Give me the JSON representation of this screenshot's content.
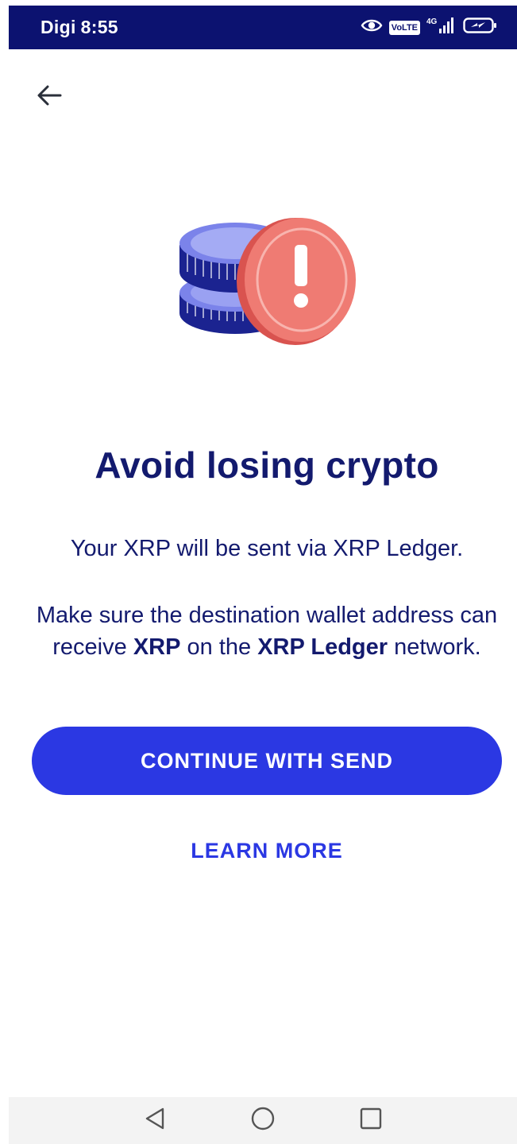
{
  "status_bar": {
    "carrier": "Digi",
    "time": "8:55",
    "volte": "VoLTE",
    "network": "4G"
  },
  "content": {
    "title": "Avoid losing crypto",
    "line1": "Your XRP will be sent via XRP Ledger.",
    "para2_part1": "Make sure the destination wallet address can receive ",
    "para2_bold1": "XRP",
    "para2_part2": " on the ",
    "para2_bold2": "XRP Ledger",
    "para2_part3": " network."
  },
  "actions": {
    "continue_label": "CONTINUE WITH SEND",
    "learn_more_label": "LEARN MORE"
  },
  "icons": {
    "back": "arrow-left-icon",
    "illustration": "coins-warning-illustration",
    "nav_back": "triangle-back-icon",
    "nav_home": "circle-home-icon",
    "nav_recents": "square-recents-icon"
  },
  "colors": {
    "status_bar": "#0c1270",
    "primary": "#2b38e3",
    "text": "#131a6e",
    "warning": "#ea6b66"
  }
}
